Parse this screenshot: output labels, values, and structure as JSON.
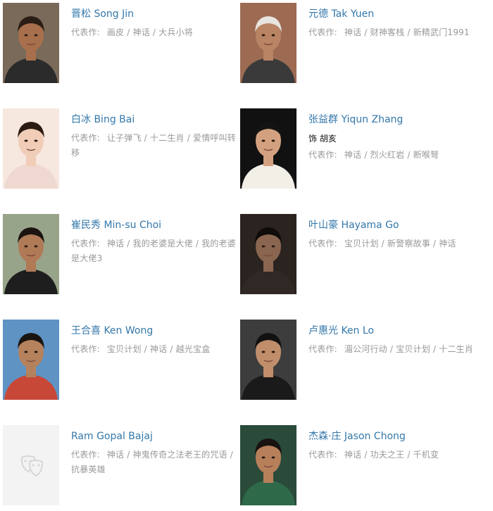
{
  "celebrities": [
    {
      "name": "晋松 Song Jin",
      "role": "",
      "works_label": "代表作:",
      "works": "画皮 / 神话 / 大兵小将",
      "skin": "#a86f4c",
      "bg": "#7a6a5a",
      "shirt": "#2b2b2b",
      "hair": "#2a1d16"
    },
    {
      "name": "元德 Tak Yuen",
      "role": "",
      "works_label": "代表作:",
      "works": "神话 / 财神客栈 / 新精武门1991",
      "skin": "#b98463",
      "bg": "#9c6b52",
      "shirt": "#3a3a3a",
      "hair": "#e8e4e0"
    },
    {
      "name": "白冰 Bing Bai",
      "role": "",
      "works_label": "代表作:",
      "works": "让子弹飞 / 十二生肖 / 爱情呼叫转移",
      "skin": "#f1cdb8",
      "bg": "#f6e7df",
      "shirt": "#efd8cf",
      "hair": "#2a1a12"
    },
    {
      "name": "张益群 Yiqun Zhang",
      "role": "饰 胡亥",
      "works_label": "代表作:",
      "works": "神话 / 烈火红岩 / 断喉弩",
      "skin": "#d3a17f",
      "bg": "#111111",
      "shirt": "#f2efe7",
      "hair": "#141414"
    },
    {
      "name": "崔民秀 Min-su Choi",
      "role": "",
      "works_label": "代表作:",
      "works": "神话 / 我的老婆是大佬 / 我的老婆是大佬3",
      "skin": "#b07a57",
      "bg": "#98a48a",
      "shirt": "#1e1e1e",
      "hair": "#1c1410"
    },
    {
      "name": "叶山豪 Hayama Go",
      "role": "",
      "works_label": "代表作:",
      "works": "宝贝计划 / 新警察故事 / 神话",
      "skin": "#8a6650",
      "bg": "#2a231f",
      "shirt": "#302824",
      "hair": "#0f0c0a"
    },
    {
      "name": "王合喜 Ken Wong",
      "role": "",
      "works_label": "代表作:",
      "works": "宝贝计划 / 神话 / 越光宝盒",
      "skin": "#b5825e",
      "bg": "#5e93c4",
      "shirt": "#c84838",
      "hair": "#1a1410"
    },
    {
      "name": "卢惠光 Ken Lo",
      "role": "",
      "works_label": "代表作:",
      "works": "湄公河行动 / 宝贝计划 / 十二生肖",
      "skin": "#c08e6b",
      "bg": "#3d3d3d",
      "shirt": "#1a1a1a",
      "hair": "#111111"
    },
    {
      "name": "Ram Gopal Bajaj",
      "role": "",
      "works_label": "代表作:",
      "works": "神话 / 神鬼传奇之法老王的咒语 / 抗暴英雄",
      "skin": "",
      "bg": "#f3f3f3",
      "shirt": "",
      "hair": "",
      "placeholder": true
    },
    {
      "name": "杰森·庄 Jason Chong",
      "role": "",
      "works_label": "代表作:",
      "works": "神话 / 功夫之王 / 千机变",
      "skin": "#b7805a",
      "bg": "#2a4a3a",
      "shirt": "#2e6a4a",
      "hair": "#181210"
    }
  ]
}
